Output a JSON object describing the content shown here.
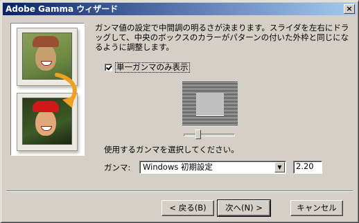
{
  "window": {
    "title": "Adobe Gamma ウィザード"
  },
  "titlebar": {
    "close_label": "×"
  },
  "instruction": "ガンマ値の設定で中間調の明るさが決まります。スライダを左右にドラッグして、中央のボックスのカラーがパターンの付いた外枠と同じになるように調整します。",
  "single_gamma": {
    "label": "単一ガンマのみ表示",
    "checked": true
  },
  "gamma_slider": {
    "value_fraction": 0.25
  },
  "select_prompt": "使用するガンマを選択してください。",
  "gamma": {
    "label": "ガンマ:",
    "selected": "Windows 初期設定",
    "value": "2.20"
  },
  "buttons": {
    "back": "< 戻る(B)",
    "next": "次へ(N) >",
    "cancel": "キャンセル"
  },
  "colors": {
    "titlebar_start": "#0a246a",
    "titlebar_end": "#a6caf0",
    "face": "#d4d0c8",
    "arrow": "#f0a020"
  },
  "icons": [
    "close-icon",
    "checkmark-icon",
    "dropdown-arrow-icon",
    "arrow-down-icon"
  ]
}
